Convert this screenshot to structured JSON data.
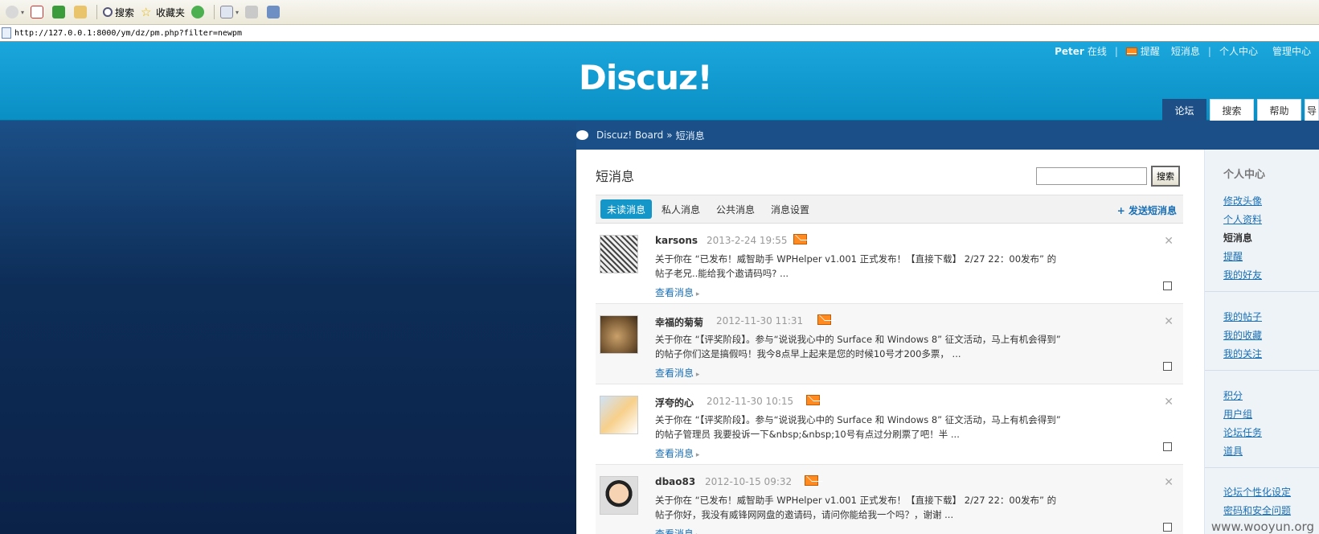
{
  "browser": {
    "toolbar": {
      "search_label": "搜索",
      "favorites_label": "收藏夹"
    },
    "address": "http://127.0.0.1:8000/ym/dz/pm.php?filter=newpm"
  },
  "header": {
    "logo": "Discuz!",
    "topnav": {
      "user": "Peter",
      "status": "在线",
      "remind": "提醒",
      "pm": "短消息",
      "usercenter": "个人中心",
      "admin": "管理中心"
    },
    "nav_tabs": [
      "论坛",
      "搜索",
      "帮助",
      "导"
    ]
  },
  "breadcrumb": {
    "home": "Discuz! Board",
    "sep": "»",
    "current": "短消息"
  },
  "main": {
    "title": "短消息",
    "search_button": "搜索",
    "search_value": "",
    "tabs": [
      "未读消息",
      "私人消息",
      "公共消息",
      "消息设置"
    ],
    "send_link": "+ 发送短消息",
    "messages": [
      {
        "name": "karsons",
        "date": "2013-2-24 19:55",
        "text": "关于你在 “已发布！威智助手 WPHelper v1.001 正式发布！【直接下载】 2/27 22：00发布” 的帖子老兄..能给我个邀请码吗? ...",
        "view": "查看消息"
      },
      {
        "name": "幸福的菊菊",
        "date": "2012-11-30 11:31",
        "text": "关于你在 “【评奖阶段】。参与“说说我心中的 Surface 和 Windows 8” 征文活动，马上有机会得到” 的帖子你们这是搞假吗！我今8点早上起来是您的时候10号才200多票， ...",
        "view": "查看消息"
      },
      {
        "name": "浮夸的心",
        "date": "2012-11-30 10:15",
        "text": "关于你在 “【评奖阶段】。参与“说说我心中的 Surface 和 Windows 8” 征文活动，马上有机会得到” 的帖子管理员 我要投诉一下&nbsp;&nbsp;10号有点过分刷票了吧！半 ...",
        "view": "查看消息"
      },
      {
        "name": "dbao83",
        "date": "2012-10-15 09:32",
        "text": "关于你在 “已发布！威智助手 WPHelper v1.001 正式发布！【直接下载】 2/27 22：00发布” 的帖子你好，我没有威锋网网盘的邀请码，请问你能给我一个吗？，谢谢 ...",
        "view": "查看消息"
      }
    ]
  },
  "sidebar": {
    "title": "个人中心",
    "group1": [
      "修改头像",
      "个人资料",
      "短消息",
      "提醒",
      "我的好友"
    ],
    "group2": [
      "我的帖子",
      "我的收藏",
      "我的关注"
    ],
    "group3": [
      "积分",
      "用户组",
      "论坛任务",
      "道具"
    ],
    "group4": [
      "论坛个性化设定",
      "密码和安全问题"
    ]
  },
  "watermark": "www.wooyun.org",
  "colors": {
    "header_blue": "#0a8fc4",
    "dark_navy": "#0d2d57",
    "link_blue": "#1a6fb4",
    "envelope_orange": "#ff8a1f"
  }
}
